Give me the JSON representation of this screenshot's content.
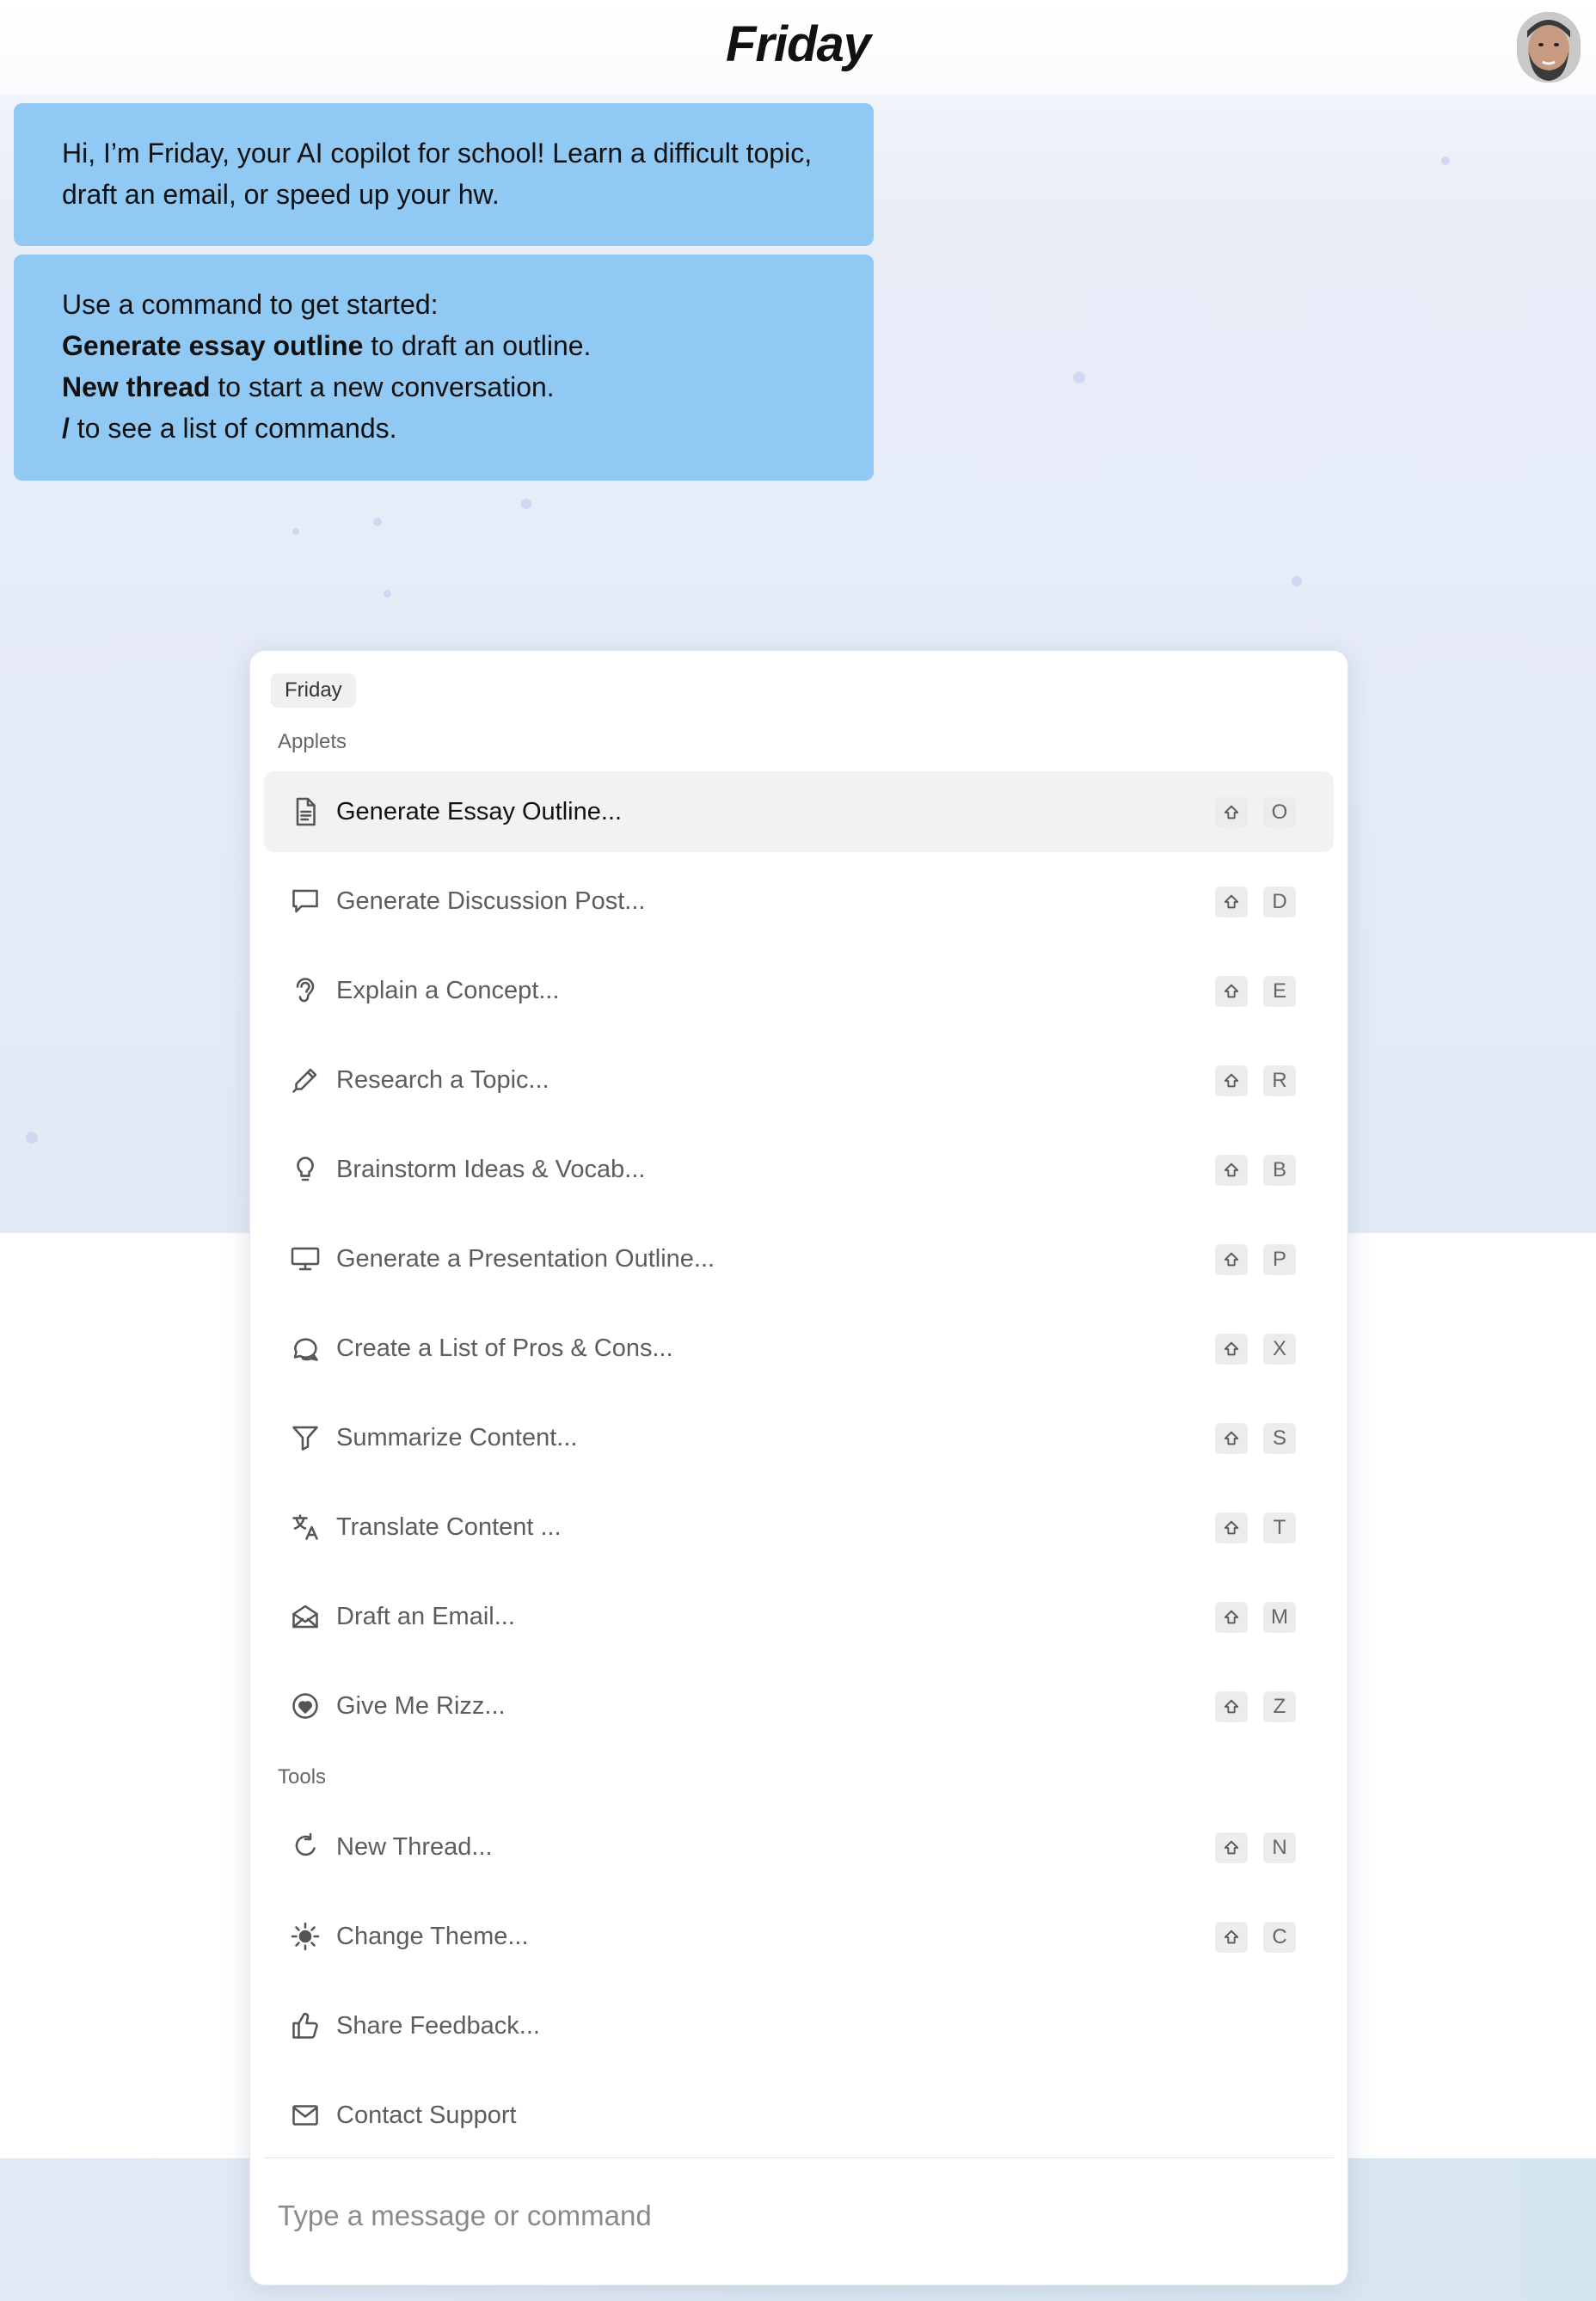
{
  "header": {
    "title": "Friday"
  },
  "messages": {
    "intro": "Hi, I’m Friday, your AI copilot for school! Learn a difficult topic, draft an email, or speed up your hw.",
    "help": {
      "lead": "Use a command to get started:",
      "cmd1_bold": "Generate essay outline",
      "cmd1_rest": " to draft an outline.",
      "cmd2_bold": "New thread",
      "cmd2_rest": " to start a new conversation.",
      "cmd3_bold": "/",
      "cmd3_rest": " to see a list of commands."
    }
  },
  "palette": {
    "breadcrumb": "Friday",
    "applets_heading": "Applets",
    "tools_heading": "Tools",
    "applets": [
      {
        "label": "Generate Essay Outline...",
        "key": "O",
        "icon": "document-icon"
      },
      {
        "label": "Generate Discussion Post...",
        "key": "D",
        "icon": "speech-bubble-icon"
      },
      {
        "label": "Explain a Concept...",
        "key": "E",
        "icon": "ear-icon"
      },
      {
        "label": "Research a Topic...",
        "key": "R",
        "icon": "eyedropper-icon"
      },
      {
        "label": "Brainstorm Ideas & Vocab...",
        "key": "B",
        "icon": "lightbulb-icon"
      },
      {
        "label": "Generate a Presentation Outline...",
        "key": "P",
        "icon": "monitor-icon"
      },
      {
        "label": "Create a List of Pros & Cons...",
        "key": "X",
        "icon": "chat-bubbles-icon"
      },
      {
        "label": "Summarize Content...",
        "key": "S",
        "icon": "filter-icon"
      },
      {
        "label": "Translate Content ...",
        "key": "T",
        "icon": "translate-icon"
      },
      {
        "label": "Draft an Email...",
        "key": "M",
        "icon": "open-envelope-icon"
      },
      {
        "label": "Give Me Rizz...",
        "key": "Z",
        "icon": "heart-circle-icon"
      }
    ],
    "tools": [
      {
        "label": "New Thread...",
        "key": "N",
        "icon": "refresh-icon"
      },
      {
        "label": "Change Theme...",
        "key": "C",
        "icon": "sun-icon"
      },
      {
        "label": "Share Feedback...",
        "key": "",
        "icon": "thumbs-up-icon"
      },
      {
        "label": "Contact Support",
        "key": "",
        "icon": "envelope-icon"
      }
    ],
    "input_placeholder": "Type a message or command"
  }
}
